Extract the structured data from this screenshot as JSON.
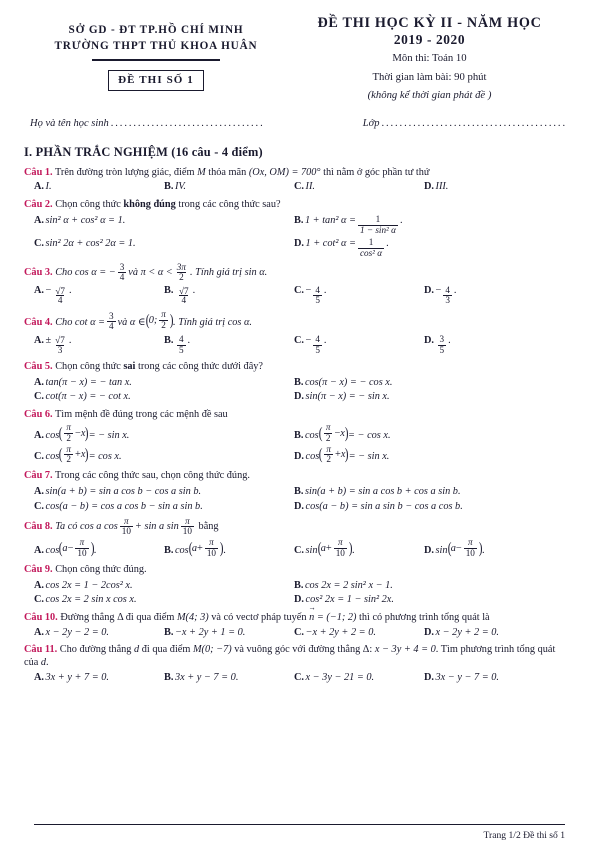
{
  "header": {
    "school_line1": "SỞ GD - ĐT TP.HỒ CHÍ MINH",
    "school_line2": "TRƯỜNG THPT THỦ KHOA HUÂN",
    "exam_code_label": "ĐỀ THI SỐ  1",
    "exam_title": "ĐỀ THI HỌC KỲ II - NĂM HỌC",
    "exam_year": "2019 - 2020",
    "subject": "Môn thi: Toán 10",
    "duration": "Thời gian làm bài: 90 phút",
    "note": "(không kể thời gian phát đề )"
  },
  "student": {
    "name_label": "Họ và tên học sinh",
    "class_label": "Lớp"
  },
  "section": {
    "title": "I. PHẦN TRẮC NGHIỆM (16 câu - 4 điểm)"
  },
  "questions": [
    {
      "label": "Câu 1.",
      "text_1": "Trên đường tròn lượng giác, điểm ",
      "var_M": "M",
      "text_2": " thỏa mãn ",
      "expr": "(Ox, OM) = 700°",
      "text_3": " thì nằm ở góc phần tư thứ",
      "layout": "4col",
      "options": [
        "I.",
        "IV.",
        "II.",
        "III."
      ]
    },
    {
      "label": "Câu 2.",
      "text_1": "Chọn công thức ",
      "bold": "không đúng",
      "text_2": " trong các công thức sau?",
      "layout": "2col-frac"
    },
    {
      "label": "Câu 3.",
      "text_1": "Cho cos α = ",
      "val": "-3/4",
      "text_2": " và π < α < 3π/2. Tính giá trị sin α.",
      "layout": "4col-frac"
    },
    {
      "label": "Câu 4.",
      "text_1": "Cho cot α = ",
      "val": "3/4",
      "text_2": " và α ∈ (0; π/2). Tính giá trị cos α.",
      "layout": "4col-frac"
    },
    {
      "label": "Câu 5.",
      "text_1": "Chọn công thức ",
      "bold": "sai",
      "text_2": " trong các công thức dưới đây?",
      "layout": "2col",
      "options": [
        "tan(π − x) = − tan x.",
        "cos(π − x) = − cos x.",
        "cot(π − x) = − cot x.",
        "sin(π − x) = − sin x."
      ]
    },
    {
      "label": "Câu 6.",
      "text_1": "Tìm mệnh đề đúng trong các mệnh đề sau",
      "layout": "2col-frac"
    },
    {
      "label": "Câu 7.",
      "text_1": "Trong các công thức sau, chọn công thức đúng.",
      "layout": "2col",
      "options": [
        "sin(a + b) = sin a cos b − cos a sin b.",
        "sin(a + b) = sin a cos b + cos a sin b.",
        "cos(a − b) = cos a cos b − sin a sin b.",
        "cos(a − b) = sin a sin b − cos a cos b."
      ]
    },
    {
      "label": "Câu 8.",
      "text_1": "Ta có cos a cos π/10 + sin a sin π/10 bằng",
      "layout": "4col-frac"
    },
    {
      "label": "Câu 9.",
      "text_1": "Chọn công thức đúng.",
      "layout": "2col-sup",
      "options": [
        "cos 2x = 1 − 2cos² x.",
        "cos 2x = 2 sin² x − 1.",
        "cos 2x = 2 sin x cos x.",
        "cos² 2x = 1 − sin² 2x."
      ]
    },
    {
      "label": "Câu 10.",
      "text_1": "Đường thẳng Δ đi qua điểm ",
      "point": "M(4; 3)",
      "text_2": " và có vectơ pháp tuyến ",
      "vec": "n",
      "text_3": " = (−1; 2) thì có phương trình tổng quát là",
      "layout": "4col",
      "options": [
        "x − 2y − 2 = 0.",
        "−x + 2y + 1 = 0.",
        "−x + 2y + 2 = 0.",
        "x − 2y + 2 = 0."
      ]
    },
    {
      "label": "Câu 11.",
      "text_1": "Cho đường thẳng ",
      "var_d": "d",
      "text_2": " đi qua điểm ",
      "point": "M(0; −7)",
      "text_3": " và vuông góc với đường thẳng Δ: ",
      "line_eq": "x − 3y + 4 = 0",
      "text_4": ". Tìm phương trình tổng quát của ",
      "var_d2": "d",
      "text_5": ".",
      "layout": "4col",
      "options": [
        "3x + y + 7 = 0.",
        "3x + y − 7 = 0.",
        "x − 3y − 21 = 0.",
        "3x − y − 7 = 0."
      ]
    }
  ],
  "q2_options": {
    "a": "sin² α + cos² α = 1.",
    "b_lead": "1 + tan² α =",
    "b_num": "1",
    "b_den": "1 − sin² α",
    "c": "sin² 2α + cos² 2α = 1.",
    "d_lead": "1 + cot² α =",
    "d_num": "1",
    "d_den": "cos² α"
  },
  "q3": {
    "lead": "Cho cos α = −",
    "frac1_num": "3",
    "frac1_den": "4",
    "mid": "và π < α <",
    "frac2_num": "3π",
    "frac2_den": "2",
    "tail": ". Tính giá trị sin α.",
    "options": [
      {
        "sign": "−",
        "num": "√7",
        "den": "4",
        "radical": true
      },
      {
        "sign": "",
        "num": "√7",
        "den": "4",
        "radical": true
      },
      {
        "sign": "−",
        "num": "4",
        "den": "5",
        "radical": false
      },
      {
        "sign": "−",
        "num": "4",
        "den": "3",
        "radical": false
      }
    ]
  },
  "q4": {
    "lead": "Cho cot α =",
    "frac1_num": "3",
    "frac1_den": "4",
    "mid": "và α ∈",
    "inner_lead": "0;",
    "frac2_num": "π",
    "frac2_den": "2",
    "tail": ". Tính giá trị cos α.",
    "options": [
      {
        "sign": "±",
        "num": "√7",
        "den": "3",
        "radical": true
      },
      {
        "sign": "",
        "num": "4",
        "den": "5",
        "radical": false
      },
      {
        "sign": "−",
        "num": "4",
        "den": "5",
        "radical": false
      },
      {
        "sign": "",
        "num": "3",
        "den": "5",
        "radical": false
      }
    ]
  },
  "q6": {
    "options": [
      {
        "fn": "cos",
        "inner_op": "−",
        "arg": "x",
        "rhs": "= − sin x."
      },
      {
        "fn": "cos",
        "inner_op": "−",
        "arg": "x",
        "rhs": "= − cos x."
      },
      {
        "fn": "cos",
        "inner_op": "+",
        "arg": "x",
        "rhs": "= cos x."
      },
      {
        "fn": "cos",
        "inner_op": "+",
        "arg": "x",
        "rhs": "= − sin x."
      }
    ],
    "frac_num": "π",
    "frac_den": "2"
  },
  "q8": {
    "lead": "Ta có cos a cos",
    "frac1_num": "π",
    "frac1_den": "10",
    "mid": "+ sin a sin",
    "frac2_num": "π",
    "frac2_den": "10",
    "tail": "bằng",
    "options": [
      {
        "fn": "cos",
        "op": "−"
      },
      {
        "fn": "cos",
        "op": "+"
      },
      {
        "fn": "sin",
        "op": "+"
      },
      {
        "fn": "sin",
        "op": "−"
      }
    ],
    "arg": "a",
    "opt_num": "π",
    "opt_den": "10"
  },
  "q10": {
    "lead": "Đường thẳng Δ đi qua điểm",
    "point": "M(4; 3)",
    "mid": "và có vectơ pháp tuyến",
    "vec": "n",
    "coords": "= (−1; 2)",
    "tail": "thì có",
    "line2": "phương trình tổng quát là"
  },
  "q11": {
    "lead": "Cho đường thẳng",
    "d": "d",
    "mid1": "đi qua điểm",
    "point": "M(0; −7)",
    "mid2": "và vuông góc với đường thẳng Δ:",
    "eq_part1": "x − 3y +",
    "eq_part2": "4 = 0",
    "tail": ". Tìm phương trình tổng quát của",
    "d2": "d",
    "period": "."
  },
  "labels": {
    "a": "A.",
    "b": "B.",
    "c": "C.",
    "d": "D."
  },
  "footer": {
    "text": "Trang 1/2 Đề thi số  1"
  },
  "colors": {
    "question_label": "#c2185b",
    "text": "#1a1a2e"
  }
}
